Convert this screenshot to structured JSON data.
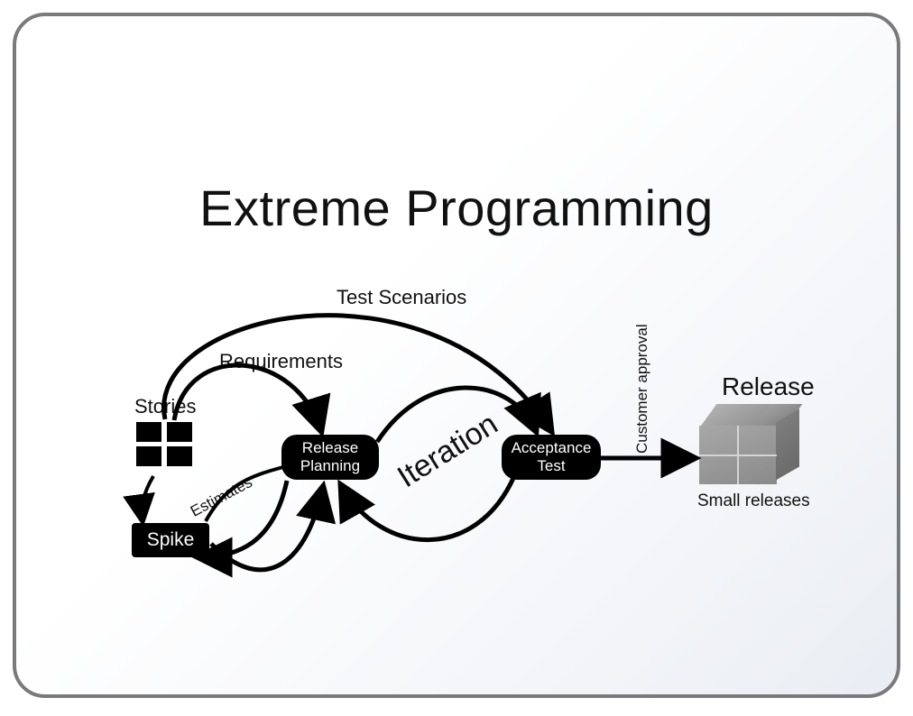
{
  "title": "Extreme Programming",
  "nodes": {
    "spike": "Spike",
    "release_planning": "Release Planning",
    "acceptance_test": "Acceptance Test",
    "release": "Release",
    "small_releases": "Small releases"
  },
  "labels": {
    "test_scenarios": "Test Scenarios",
    "requirements": "Requirements",
    "stories": "Stories",
    "iteration": "Iteration",
    "estimates": "Estimates",
    "customer_approval": "Customer approval"
  }
}
